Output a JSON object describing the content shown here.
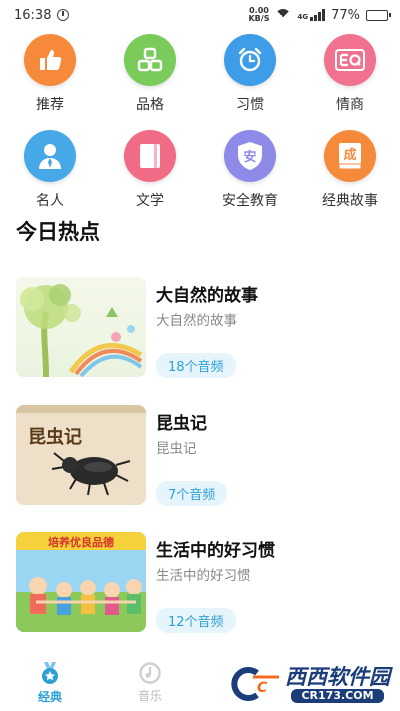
{
  "status_bar": {
    "time": "16:38",
    "net_speed_value": "0.00",
    "net_speed_unit": "KB/S",
    "network_type": "4G",
    "battery": "77%",
    "battery_level": 0.77
  },
  "categories": [
    {
      "label": "推荐",
      "icon": "thumbs-up-icon",
      "color": "#F7893A"
    },
    {
      "label": "品格",
      "icon": "blocks-icon",
      "color": "#7ACB5A"
    },
    {
      "label": "习惯",
      "icon": "alarm-clock-icon",
      "color": "#3D9DE8"
    },
    {
      "label": "情商",
      "icon": "eq-icon",
      "color": "#F0728F"
    },
    {
      "label": "名人",
      "icon": "person-icon",
      "color": "#46A8E6"
    },
    {
      "label": "文学",
      "icon": "book-icon",
      "color": "#F06B86"
    },
    {
      "label": "安全教育",
      "icon": "shield-icon",
      "color": "#8D8AE8",
      "glyph": "安"
    },
    {
      "label": "经典故事",
      "icon": "classic-book-icon",
      "color": "#F58A3B",
      "glyph": "成"
    }
  ],
  "section_title": "今日热点",
  "cards": [
    {
      "title": "大自然的故事",
      "subtitle": "大自然的故事",
      "count": "18个音频"
    },
    {
      "title": "昆虫记",
      "subtitle": "昆虫记",
      "count": "7个音频",
      "cover_text": "昆虫记"
    },
    {
      "title": "生活中的好习惯",
      "subtitle": "生活中的好习惯",
      "count": "12个音频",
      "cover_text": "培养优良品德"
    }
  ],
  "bottom_nav": {
    "items": [
      {
        "label": "经典",
        "active": true
      },
      {
        "label": "音乐",
        "active": false
      }
    ],
    "active_color": "#2EA0D6",
    "inactive_color": "#BBBBBB"
  },
  "watermark": {
    "brand": "西西软件园",
    "domain": "CR173.COM"
  }
}
